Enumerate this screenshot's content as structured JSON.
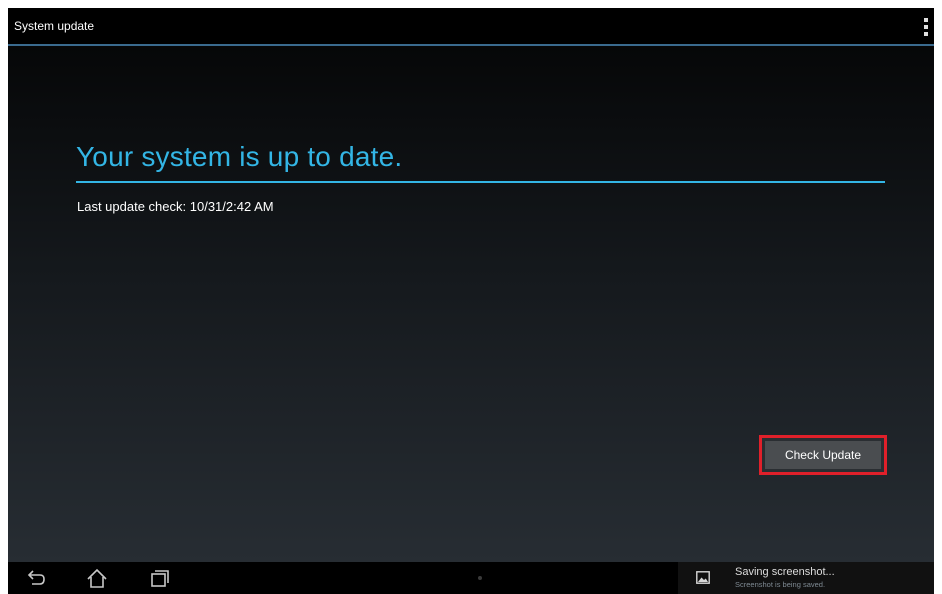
{
  "action_bar": {
    "title": "System update",
    "overflow_icon": "overflow-menu-icon"
  },
  "main": {
    "headline": "Your system is up to date.",
    "last_check": "Last update check: 10/31/2:42 AM",
    "check_update_label": "Check Update"
  },
  "navigation": {
    "back_icon": "back-icon",
    "home_icon": "home-icon",
    "recents_icon": "recent-apps-icon"
  },
  "notification": {
    "icon": "image-icon",
    "title": "Saving screenshot...",
    "subtitle": "Screenshot is being saved."
  },
  "colors": {
    "accent": "#33b5e5",
    "highlight_frame": "#e0202a",
    "button_bg": "#4a4d50",
    "background": "#000000"
  }
}
